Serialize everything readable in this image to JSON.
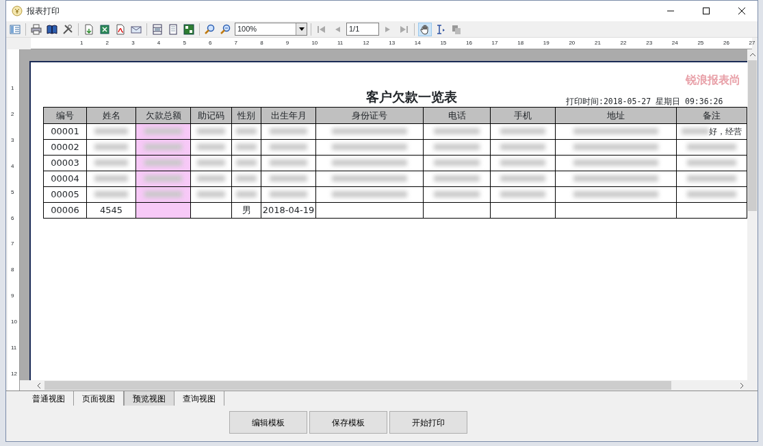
{
  "window": {
    "title": "报表打印"
  },
  "toolbar": {
    "zoom_value": "100%",
    "page_field": "1/1",
    "nav_disabled": true,
    "tools": [
      {
        "selected": true
      },
      {
        "selected": false
      }
    ]
  },
  "ruler": {
    "horizontal": [
      "1",
      "2",
      "3",
      "4",
      "5",
      "6",
      "7",
      "8",
      "9",
      "10",
      "11",
      "12",
      "13",
      "14",
      "15",
      "16",
      "17",
      "18",
      "19",
      "20",
      "21",
      "22",
      "23",
      "24",
      "25",
      "26",
      "27"
    ],
    "vertical": [
      "1",
      "2",
      "3",
      "4",
      "5",
      "6",
      "7",
      "8",
      "9",
      "10",
      "11",
      "12"
    ]
  },
  "report": {
    "stamp": "锐浪报表尚",
    "title": "客户欠款一览表",
    "print_time": "打印时间:2018-05-27 星期日 09:36:26",
    "columns": [
      {
        "label": "编号",
        "highlight": false
      },
      {
        "label": "姓名",
        "highlight": false
      },
      {
        "label": "欠款总额",
        "highlight": true
      },
      {
        "label": "助记码",
        "highlight": false
      },
      {
        "label": "性别",
        "highlight": false
      },
      {
        "label": "出生年月",
        "highlight": false
      },
      {
        "label": "身份证号",
        "highlight": false
      },
      {
        "label": "电话",
        "highlight": false
      },
      {
        "label": "手机",
        "highlight": false
      },
      {
        "label": "地址",
        "highlight": false
      },
      {
        "label": "备注",
        "highlight": false
      }
    ],
    "rows": [
      {
        "cells": [
          "00001",
          "",
          "",
          "",
          "",
          "",
          "",
          "",
          "",
          "",
          "好，经营"
        ],
        "blurred": [
          false,
          true,
          true,
          true,
          true,
          true,
          true,
          true,
          true,
          true,
          true
        ]
      },
      {
        "cells": [
          "00002",
          "",
          "",
          "",
          "",
          "",
          "",
          "",
          "",
          "",
          ""
        ],
        "blurred": [
          false,
          true,
          true,
          true,
          true,
          true,
          true,
          true,
          true,
          true,
          true
        ]
      },
      {
        "cells": [
          "00003",
          "",
          "",
          "",
          "",
          "",
          "",
          "",
          "",
          "",
          ""
        ],
        "blurred": [
          false,
          true,
          true,
          true,
          true,
          true,
          true,
          true,
          true,
          true,
          true
        ]
      },
      {
        "cells": [
          "00004",
          "",
          "",
          "",
          "",
          "",
          "",
          "",
          "",
          "",
          ""
        ],
        "blurred": [
          false,
          true,
          true,
          true,
          true,
          true,
          true,
          true,
          true,
          true,
          true
        ]
      },
      {
        "cells": [
          "00005",
          "",
          "",
          "",
          "",
          "",
          "",
          "",
          "",
          "",
          ""
        ],
        "blurred": [
          false,
          true,
          true,
          true,
          true,
          true,
          true,
          true,
          true,
          true,
          true
        ]
      },
      {
        "cells": [
          "00006",
          "4545",
          "",
          "",
          "男",
          "2018-04-19",
          "",
          "",
          "",
          "",
          ""
        ],
        "blurred": [
          false,
          false,
          false,
          false,
          false,
          false,
          false,
          false,
          false,
          false,
          false
        ]
      }
    ]
  },
  "view_tabs": [
    {
      "label": "普通视图",
      "selected": false
    },
    {
      "label": "页面视图",
      "selected": false
    },
    {
      "label": "预览视图",
      "selected": true
    },
    {
      "label": "查询视图",
      "selected": false
    }
  ],
  "buttons": [
    "编辑模板",
    "保存模板",
    "开始打印"
  ]
}
